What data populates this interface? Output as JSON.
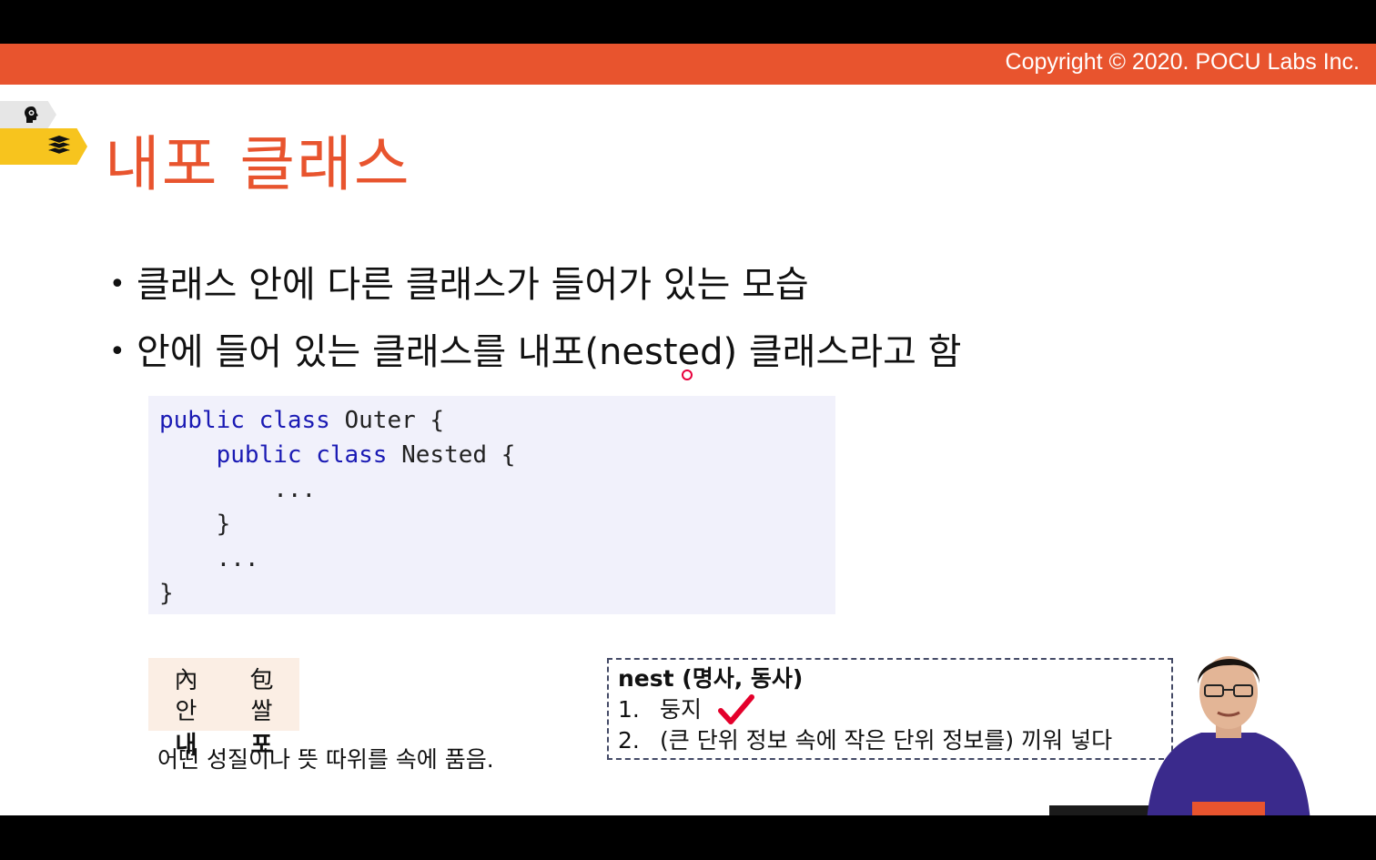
{
  "header": {
    "copyright": "Copyright © 2020. POCU Labs Inc."
  },
  "slide": {
    "title": "내포 클래스",
    "bullets": [
      "클래스 안에 다른 클래스가 들어가 있는 모습",
      "안에 들어 있는 클래스를 내포(nested) 클래스라고 함"
    ],
    "code": {
      "line1_kw": "public class",
      "line1_rest": " Outer {",
      "line2_kw": "public class",
      "line2_rest": " Nested {",
      "line3": "        ...",
      "line4": "    }",
      "line5": "    ...",
      "line6": "}"
    },
    "hanja": {
      "char1_hanja": "內",
      "char2_hanja": "包",
      "char1_gloss": "안",
      "char1_reading": "내",
      "char2_gloss": "쌀",
      "char2_reading": "포"
    },
    "meaning": "어떤 성질이나 뜻 따위를 속에 품음.",
    "nest_definition": {
      "heading": "nest (명사, 동사)",
      "items": [
        {
          "num": "1.",
          "text": "둥지"
        },
        {
          "num": "2.",
          "text": "(큰 단위 정보 속에 작은 단위 정보를) 끼워 넣다"
        }
      ]
    }
  },
  "colors": {
    "accent": "#e8542e",
    "keyword": "#1a1ab4",
    "tab_yellow": "#f7c41e",
    "check_red": "#e4002b"
  },
  "icons": [
    "head-gear-icon",
    "books-stack-icon",
    "checkmark-icon"
  ]
}
